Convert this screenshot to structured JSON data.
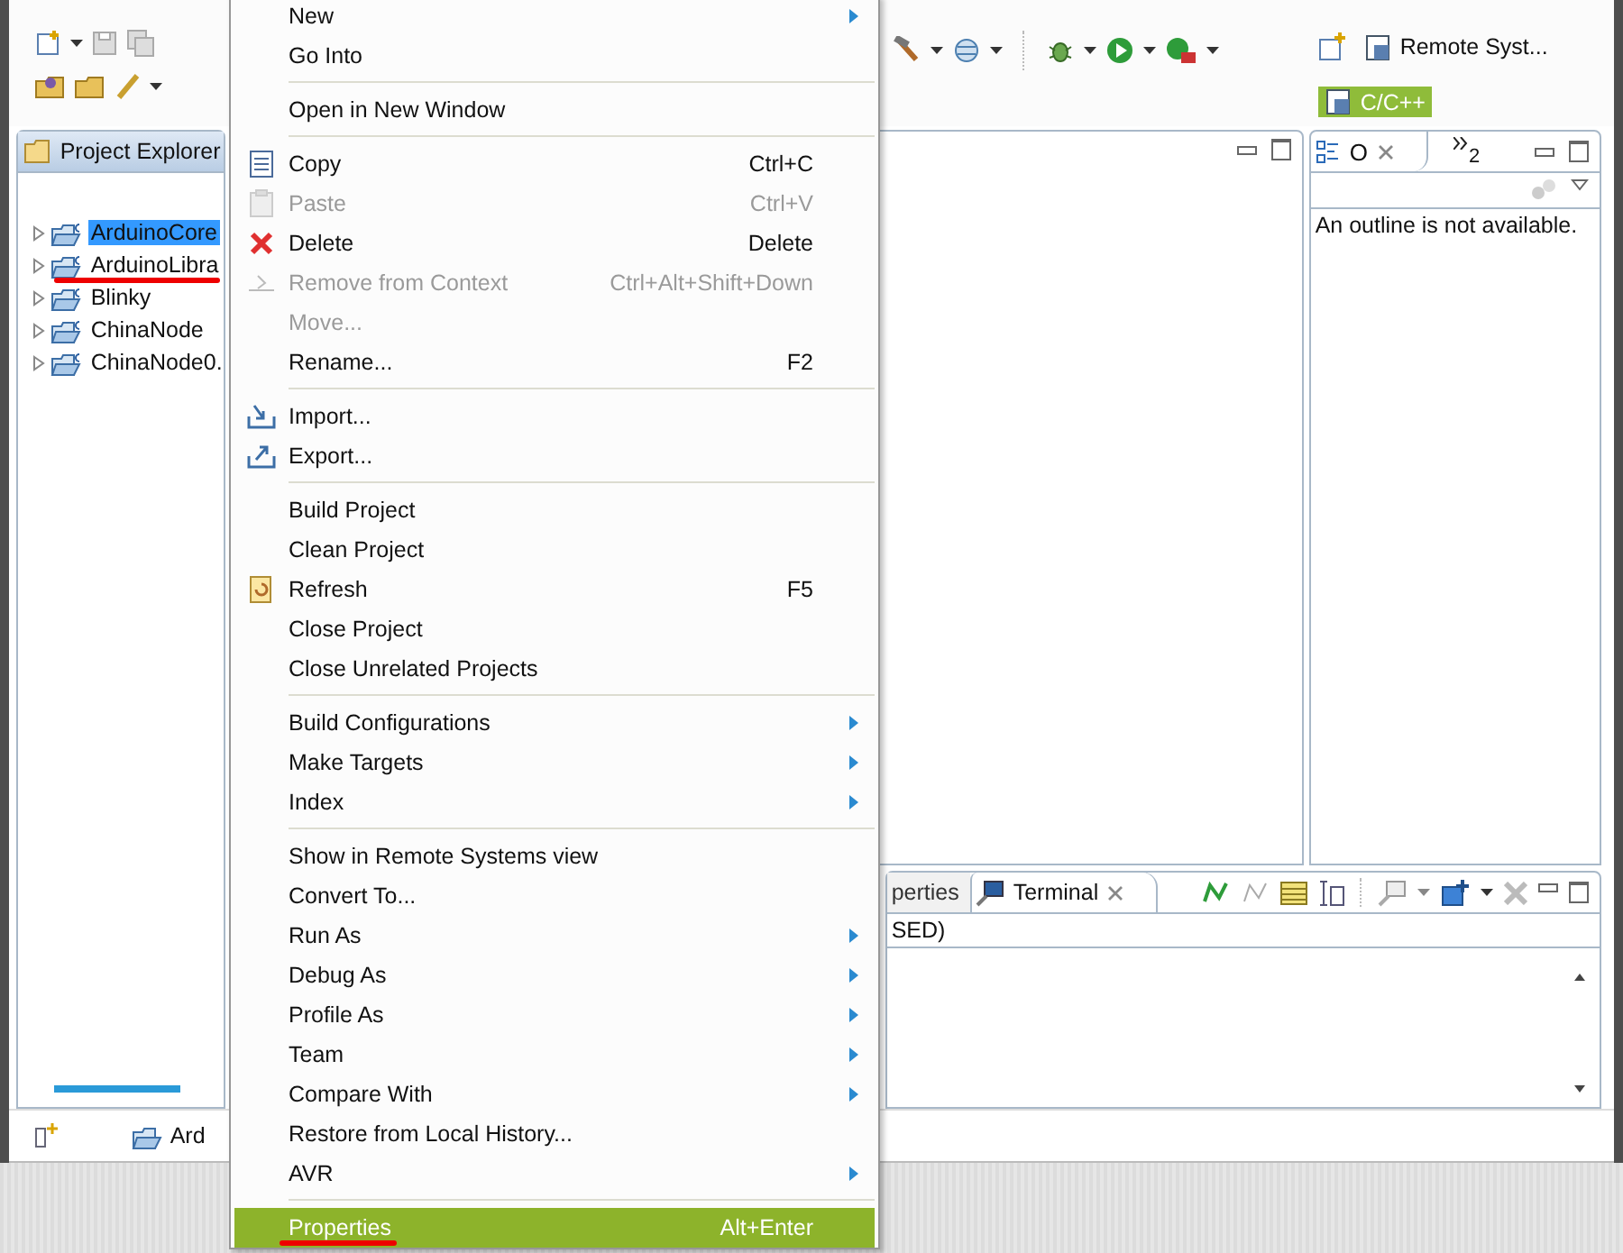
{
  "perspectives": [
    {
      "label": "Remote Syst...",
      "selected": false
    },
    {
      "label": "C/C++",
      "selected": true
    }
  ],
  "project_explorer": {
    "title": "Project Explorer",
    "items": [
      {
        "label": "ArduinoCore",
        "selected": true,
        "expanded": false
      },
      {
        "label": "ArduinoLibra",
        "selected": false,
        "expanded": false
      },
      {
        "label": "Blinky",
        "selected": false,
        "expanded": false
      },
      {
        "label": "ChinaNode",
        "selected": false,
        "expanded": false
      },
      {
        "label": "ChinaNode0.",
        "selected": false,
        "expanded": false
      }
    ]
  },
  "outline": {
    "tab": "O",
    "overflow_count": "2",
    "message": "An outline is not available."
  },
  "bottom_panel": {
    "tabs": [
      {
        "label": "perties",
        "selected": false
      },
      {
        "label": "Terminal",
        "selected": true
      }
    ],
    "status_line": "SED)"
  },
  "status_bar": {
    "item": "Ard"
  },
  "context_menu": [
    {
      "kind": "plain",
      "label": "New",
      "submenu": true,
      "disabled": false,
      "selected": false
    },
    {
      "kind": "plain",
      "label": "Go Into",
      "submenu": false,
      "disabled": false,
      "selected": false
    },
    {
      "kind": "separator"
    },
    {
      "kind": "plain",
      "label": "Open in New Window",
      "submenu": false,
      "disabled": false,
      "selected": false
    },
    {
      "kind": "separator"
    },
    {
      "kind": "copy",
      "label": "Copy",
      "shortcut": "Ctrl+C",
      "submenu": false,
      "disabled": false,
      "selected": false
    },
    {
      "kind": "paste",
      "label": "Paste",
      "shortcut": "Ctrl+V",
      "submenu": false,
      "disabled": true,
      "selected": false
    },
    {
      "kind": "delete",
      "label": "Delete",
      "shortcut": "Delete",
      "submenu": false,
      "disabled": false,
      "selected": false
    },
    {
      "kind": "remove",
      "label": "Remove from Context",
      "shortcut": "Ctrl+Alt+Shift+Down",
      "submenu": false,
      "disabled": true,
      "selected": false
    },
    {
      "kind": "plain",
      "label": "Move...",
      "submenu": false,
      "disabled": true,
      "selected": false
    },
    {
      "kind": "plain",
      "label": "Rename...",
      "shortcut": "F2",
      "submenu": false,
      "disabled": false,
      "selected": false
    },
    {
      "kind": "separator"
    },
    {
      "kind": "import",
      "label": "Import...",
      "submenu": false,
      "disabled": false,
      "selected": false
    },
    {
      "kind": "export",
      "label": "Export...",
      "submenu": false,
      "disabled": false,
      "selected": false
    },
    {
      "kind": "separator"
    },
    {
      "kind": "plain",
      "label": "Build Project",
      "submenu": false,
      "disabled": false,
      "selected": false
    },
    {
      "kind": "plain",
      "label": "Clean Project",
      "submenu": false,
      "disabled": false,
      "selected": false
    },
    {
      "kind": "refresh",
      "label": "Refresh",
      "shortcut": "F5",
      "submenu": false,
      "disabled": false,
      "selected": false
    },
    {
      "kind": "plain",
      "label": "Close Project",
      "submenu": false,
      "disabled": false,
      "selected": false
    },
    {
      "kind": "plain",
      "label": "Close Unrelated Projects",
      "submenu": false,
      "disabled": false,
      "selected": false
    },
    {
      "kind": "separator"
    },
    {
      "kind": "plain",
      "label": "Build Configurations",
      "submenu": true,
      "disabled": false,
      "selected": false
    },
    {
      "kind": "plain",
      "label": "Make Targets",
      "submenu": true,
      "disabled": false,
      "selected": false
    },
    {
      "kind": "plain",
      "label": "Index",
      "submenu": true,
      "disabled": false,
      "selected": false
    },
    {
      "kind": "separator"
    },
    {
      "kind": "plain",
      "label": "Show in Remote Systems view",
      "submenu": false,
      "disabled": false,
      "selected": false
    },
    {
      "kind": "plain",
      "label": "Convert To...",
      "submenu": false,
      "disabled": false,
      "selected": false
    },
    {
      "kind": "plain",
      "label": "Run As",
      "submenu": true,
      "disabled": false,
      "selected": false
    },
    {
      "kind": "plain",
      "label": "Debug As",
      "submenu": true,
      "disabled": false,
      "selected": false
    },
    {
      "kind": "plain",
      "label": "Profile As",
      "submenu": true,
      "disabled": false,
      "selected": false
    },
    {
      "kind": "plain",
      "label": "Team",
      "submenu": true,
      "disabled": false,
      "selected": false
    },
    {
      "kind": "plain",
      "label": "Compare With",
      "submenu": true,
      "disabled": false,
      "selected": false
    },
    {
      "kind": "plain",
      "label": "Restore from Local History...",
      "submenu": false,
      "disabled": false,
      "selected": false
    },
    {
      "kind": "plain",
      "label": "AVR",
      "submenu": true,
      "disabled": false,
      "selected": false
    },
    {
      "kind": "separator"
    },
    {
      "kind": "plain",
      "label": "Properties",
      "shortcut": "Alt+Enter",
      "submenu": false,
      "disabled": false,
      "selected": true
    }
  ]
}
